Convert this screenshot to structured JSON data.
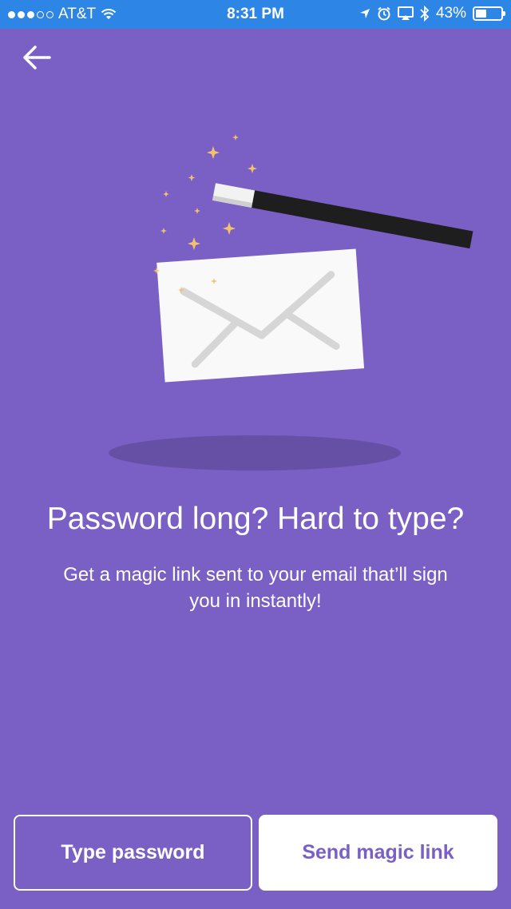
{
  "status_bar": {
    "carrier": "AT&T",
    "time": "8:31 PM",
    "battery_percent": "43%",
    "battery_level": 0.43,
    "signal_bars_filled": 3,
    "signal_bars_total": 5,
    "icons": [
      "wifi-icon",
      "location-arrow-icon",
      "alarm-icon",
      "airplay-icon",
      "bluetooth-icon",
      "battery-icon"
    ],
    "color": "#2d86e6"
  },
  "nav": {
    "back_icon": "arrow-left-icon"
  },
  "illustration": {
    "icons": [
      "magic-wand-icon",
      "envelope-icon",
      "sparkle-icon",
      "shadow"
    ],
    "sparkle_color": "#f5c26b"
  },
  "content": {
    "headline": "Password long? Hard to type?",
    "subtext": "Get a magic link sent to your email that’ll sign you in instantly!"
  },
  "actions": {
    "type_password_label": "Type password",
    "send_magic_link_label": "Send magic link"
  },
  "colors": {
    "background": "#7a5fc4",
    "accent": "#7a5fc4",
    "text": "#ffffff"
  }
}
